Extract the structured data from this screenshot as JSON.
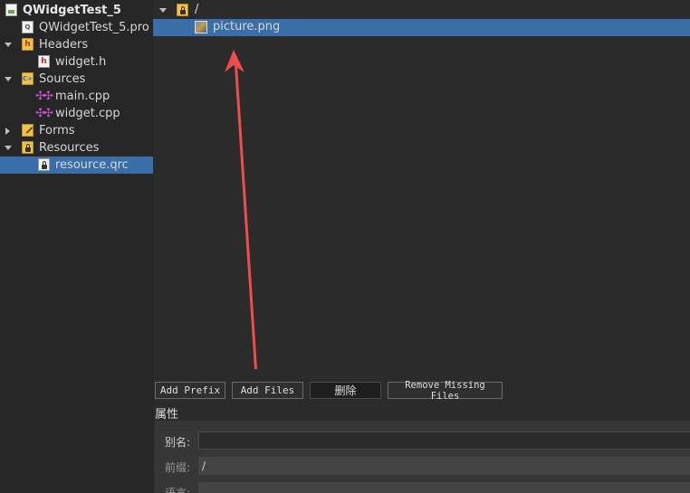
{
  "project_tree": {
    "items": [
      {
        "label": "QWidgetTest_5",
        "icon": "project-icon",
        "expander": "none"
      },
      {
        "label": "QWidgetTest_5.pro",
        "icon": "pro-file-icon",
        "expander": "none"
      },
      {
        "label": "Headers",
        "icon": "headers-folder-icon",
        "expander": "expanded"
      },
      {
        "label": "widget.h",
        "icon": "header-file-icon",
        "expander": "none"
      },
      {
        "label": "Sources",
        "icon": "sources-folder-icon",
        "expander": "expanded"
      },
      {
        "label": "main.cpp",
        "icon": "cpp-file-icon",
        "expander": "none"
      },
      {
        "label": "widget.cpp",
        "icon": "cpp-file-icon",
        "expander": "none"
      },
      {
        "label": "Forms",
        "icon": "forms-folder-icon",
        "expander": "collapsed"
      },
      {
        "label": "Resources",
        "icon": "resources-folder-icon",
        "expander": "expanded"
      },
      {
        "label": "resource.qrc",
        "icon": "qrc-file-icon",
        "expander": "none",
        "selected": true
      }
    ]
  },
  "resource_tree": {
    "prefix": "/",
    "files": [
      {
        "label": "picture.png",
        "icon": "image-file-icon",
        "selected": true
      }
    ]
  },
  "buttons": {
    "add_prefix": "Add Prefix",
    "add_files": "Add Files",
    "delete": "删除",
    "remove_missing": "Remove Missing Files"
  },
  "properties": {
    "title": "属性",
    "alias_label": "别名:",
    "alias_value": "",
    "prefix_label": "前缀:",
    "prefix_value": "/",
    "language_label": "语言:",
    "language_value": ""
  },
  "colors": {
    "selection": "#3a6ea8",
    "background": "#2b2b2b",
    "annotation_arrow": "#ef4d4d"
  }
}
